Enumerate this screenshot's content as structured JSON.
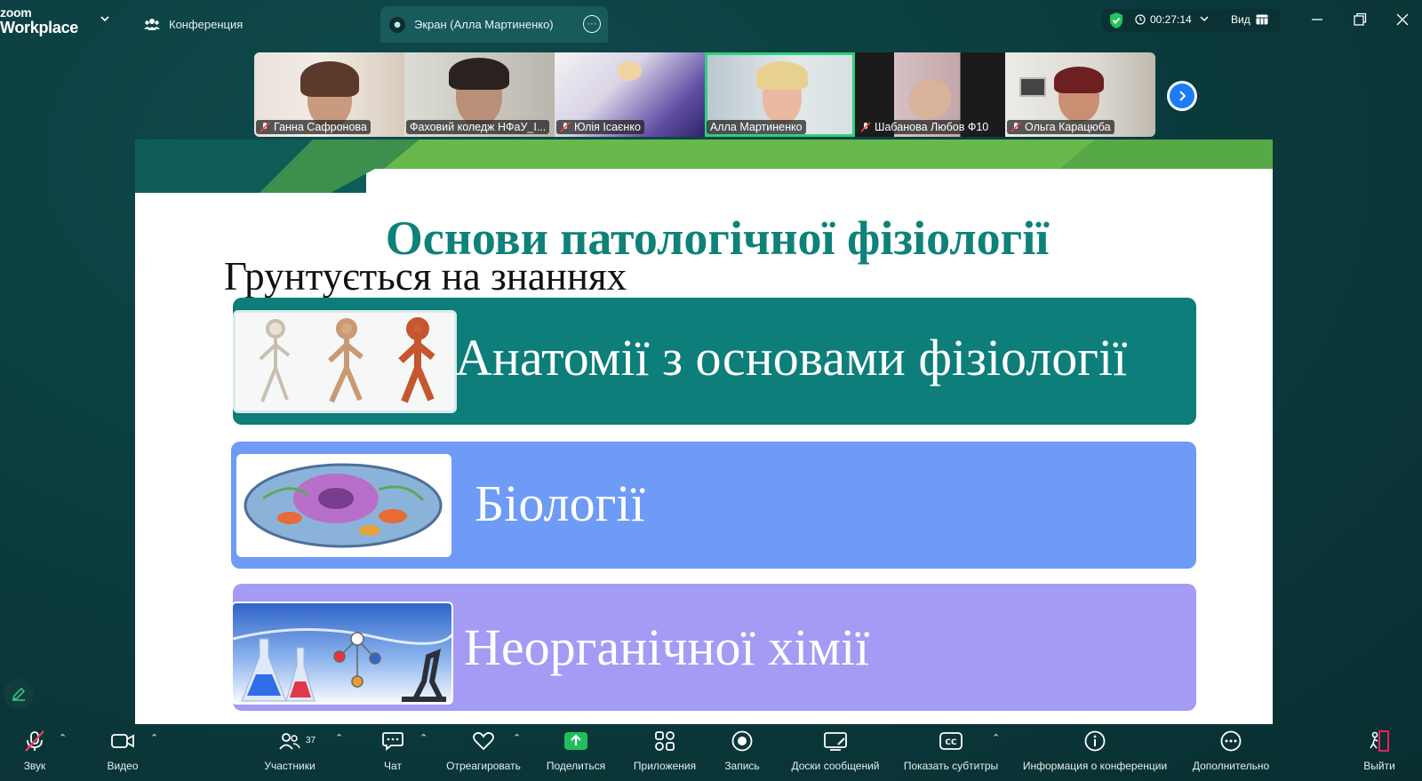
{
  "app": {
    "logo_line1": "zoom",
    "logo_line2": "Workplace"
  },
  "tabs": {
    "conference": "Конференция",
    "screen": "Экран (Алла Мартиненко)"
  },
  "status": {
    "timer": "00:27:14",
    "view_label": "Вид"
  },
  "participants": [
    {
      "name": "Ганна Сафронова",
      "muted": true
    },
    {
      "name": "Фаховий коледж НФаУ_І...",
      "muted": false
    },
    {
      "name": "Юлія Ісаєнко",
      "muted": true
    },
    {
      "name": "Алла Мартиненко",
      "muted": false,
      "active": true
    },
    {
      "name": "Шабанова Любов Ф10",
      "muted": true
    },
    {
      "name": "Ольга Карацюба",
      "muted": true
    }
  ],
  "slide": {
    "title": "Основи патологічної фізіології",
    "subtitle": "Грунтується на знаннях",
    "items": [
      {
        "label": "Анатомії з основами фізіології"
      },
      {
        "label": "Біології"
      },
      {
        "label": "Неорганічної хімії"
      }
    ]
  },
  "toolbar": {
    "audio": "Звук",
    "video": "Видео",
    "participants": "Участники",
    "participants_count": "37",
    "chat": "Чат",
    "react": "Отреагировать",
    "share": "Поделиться",
    "apps": "Приложения",
    "record": "Запись",
    "whiteboards": "Доски сообщений",
    "captions": "Показать субтитры",
    "info": "Информация о конференции",
    "more": "Дополнительно",
    "leave": "Выйти"
  },
  "colors": {
    "accent_green": "#2fd07e",
    "share_green": "#1fbf5a",
    "leave_red": "#e0245e",
    "slide_teal": "#0d7e79",
    "slide_blue": "#6e9bf6",
    "slide_violet": "#a49bf4",
    "title_teal": "#0e8278"
  }
}
